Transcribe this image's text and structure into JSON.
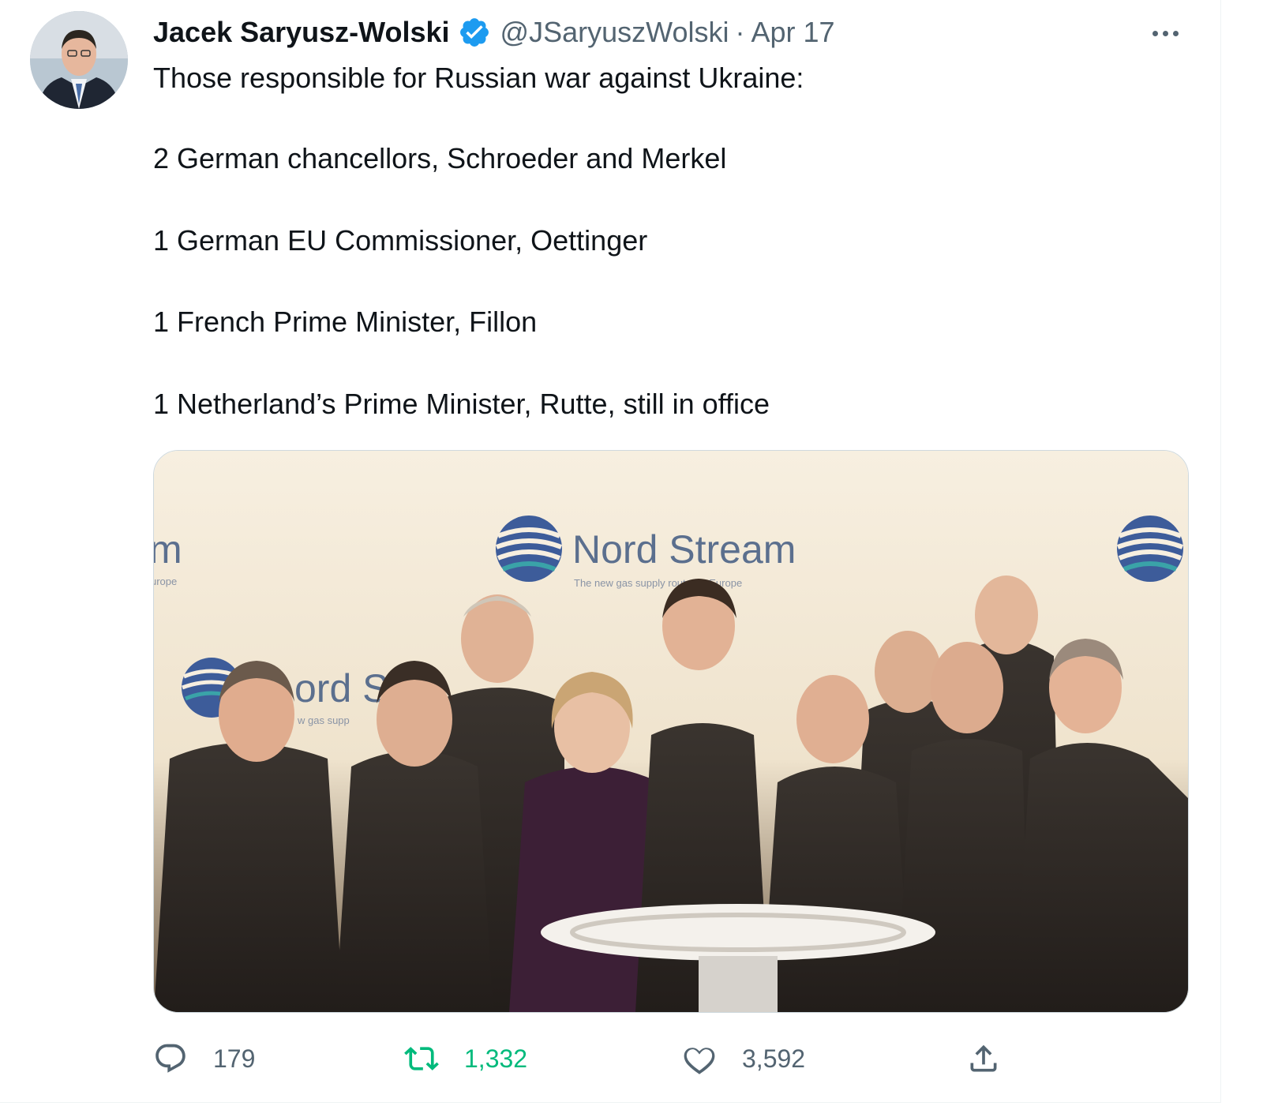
{
  "tweet": {
    "author_name": "Jacek Saryusz-Wolski",
    "handle": "@JSaryuszWolski",
    "separator": "·",
    "date": "Apr 17",
    "lines": [
      "Those responsible for Russian war against Ukraine:",
      "2 German chancellors, Schroeder and Merkel",
      "1 German EU Commissioner, Oettinger",
      "1 French Prime Minister, Fillon",
      "1 Netherland’s Prime Minister, Rutte, still in office"
    ],
    "photo": {
      "banner_main": "Nord Stream",
      "banner_sub": "The new gas supply route for Europe",
      "banner_left_fragment": "m",
      "banner_left_sub": "urope",
      "banner_second_fragment": "ord St",
      "banner_second_sub": "w gas supp"
    },
    "stats": {
      "replies": "179",
      "retweets": "1,332",
      "likes": "3,592"
    }
  },
  "colors": {
    "text_primary": "#0f1419",
    "text_secondary": "#536471",
    "verified_blue": "#1d9bf0",
    "retweet_green": "#00ba7c"
  },
  "icons": [
    "verified-badge-icon",
    "more-icon",
    "reply-icon",
    "retweet-icon",
    "like-icon",
    "share-icon"
  ]
}
